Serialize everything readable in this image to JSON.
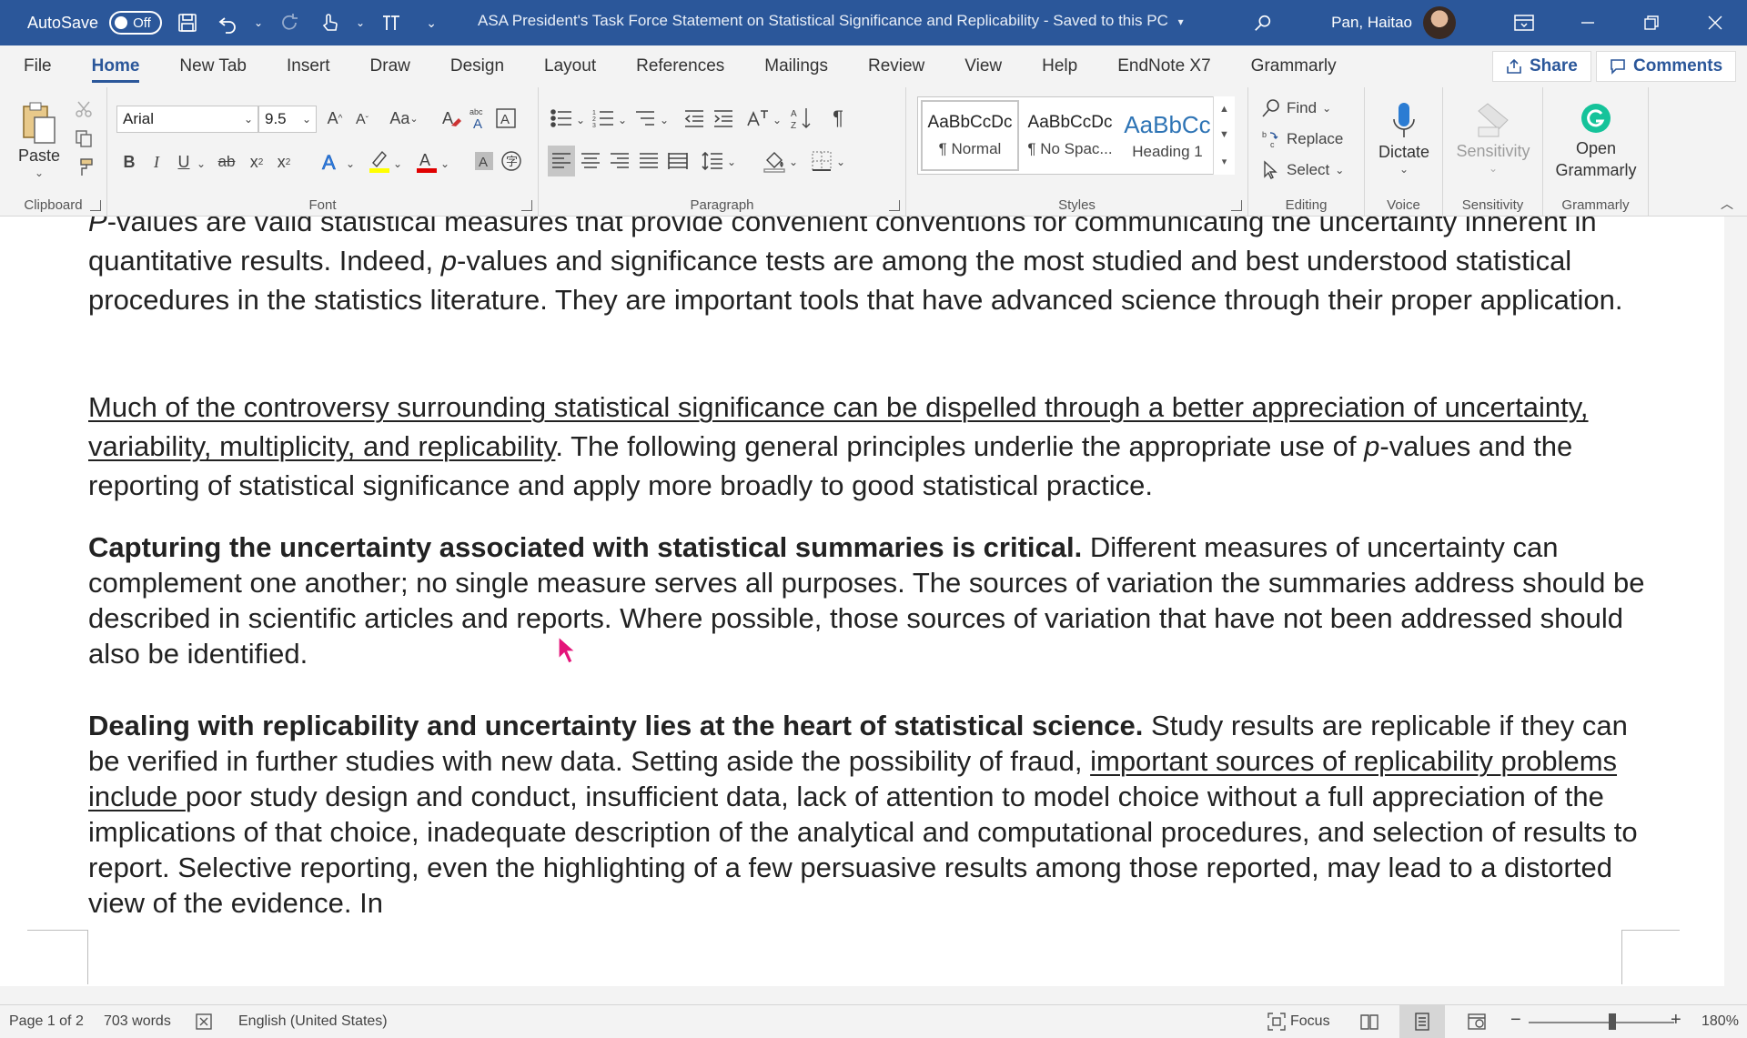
{
  "titlebar": {
    "autosave_label": "AutoSave",
    "autosave_state": "Off",
    "doc_title": "ASA President's Task Force Statement on Statistical Significance and Replicability  -  Saved to this PC",
    "user_name": "Pan, Haitao"
  },
  "tabs": [
    "File",
    "Home",
    "New Tab",
    "Insert",
    "Draw",
    "Design",
    "Layout",
    "References",
    "Mailings",
    "Review",
    "View",
    "Help",
    "EndNote X7",
    "Grammarly"
  ],
  "share_label": "Share",
  "comments_label": "Comments",
  "ribbon": {
    "clipboard": {
      "label": "Clipboard",
      "paste": "Paste"
    },
    "font": {
      "label": "Font",
      "name": "Arial",
      "size": "9.5"
    },
    "paragraph": {
      "label": "Paragraph"
    },
    "styles": {
      "label": "Styles",
      "items": [
        {
          "sample": "AaBbCcDc",
          "name": "¶ Normal"
        },
        {
          "sample": "AaBbCcDc",
          "name": "¶ No Spac..."
        },
        {
          "sample": "AaBbCc",
          "name": "Heading 1"
        }
      ]
    },
    "editing": {
      "label": "Editing",
      "find": "Find",
      "replace": "Replace",
      "select": "Select"
    },
    "voice": {
      "label": "Voice",
      "dictate": "Dictate"
    },
    "sensitivity": {
      "label": "Sensitivity",
      "button": "Sensitivity"
    },
    "grammarly": {
      "label": "Grammarly",
      "open_line1": "Open",
      "open_line2": "Grammarly"
    }
  },
  "document": {
    "p1": {
      "italic_start": "P",
      "text1": "-values are valid statistical measures that provide convenient conventions for communicating the uncertainty inherent in quantitative results. Indeed, ",
      "italic_p": "p",
      "text2": "-values and significance tests are among the most studied and best understood statistical procedures in the statistics literature. They are important tools that have advanced science through their proper application."
    },
    "p2": {
      "underlined": "Much of the controversy surrounding statistical significance can be dispelled through a better appreciation of uncertainty, variability, multiplicity, and replicability",
      "text1": ". The following general principles underlie the appropriate use of ",
      "italic_p": "p",
      "text2": "-values and the reporting of statistical significance and apply more broadly to good statistical practice."
    },
    "p3": {
      "bold": "Capturing the uncertainty associated with statistical summaries is critical.",
      "text": " Different measures of uncertainty can complement one another; no single measure serves all purposes. The sources of variation the summaries address should be described in scientific articles and reports. Where possible, those sources of variation that have not been addressed should also be identified."
    },
    "p4": {
      "bold": "Dealing with replicability and uncertainty lies at the heart of statistical science.",
      "text1": " Study results are replicable if they can be verified in further studies with new data. Setting aside the possibility of fraud, ",
      "underlined": "important sources of replicability problems include ",
      "text2": "poor study design and conduct, insufficient data, lack of attention to model choice without a full appreciation of the implications of that choice, inadequate description of the analytical and computational procedures, and selection of results to report. Selective reporting, even the highlighting of a few persuasive results among those reported, may lead to a distorted view of the evidence. In"
    }
  },
  "statusbar": {
    "page": "Page 1 of 2",
    "words": "703 words",
    "language": "English (United States)",
    "focus": "Focus",
    "zoom": "180%"
  },
  "colors": {
    "accent": "#2b579a",
    "grammarly": "#15c39a",
    "highlight": "#ffff00",
    "font_color": "#e00000"
  }
}
